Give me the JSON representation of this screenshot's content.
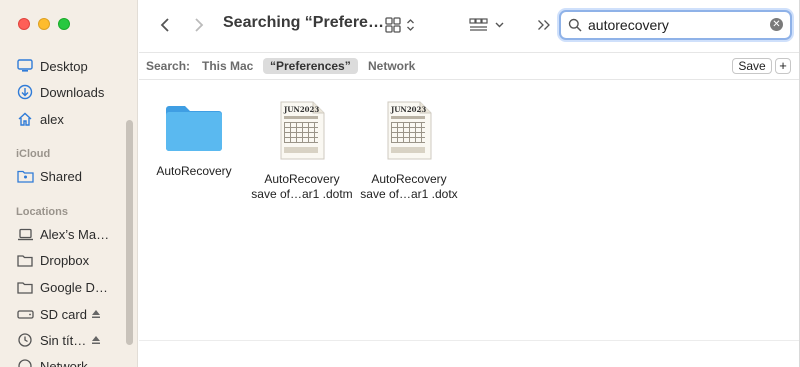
{
  "toolbar": {
    "title": "Searching “Prefere…",
    "search_value": "autorecovery"
  },
  "scope": {
    "label": "Search:",
    "options": [
      "This Mac",
      "“Preferences”",
      "Network"
    ],
    "save_label": "Save",
    "add_label": "+"
  },
  "sidebar": {
    "items_top": [
      {
        "label": "Desktop",
        "icon": "desktop-icon"
      },
      {
        "label": "Downloads",
        "icon": "downloads-icon"
      },
      {
        "label": "alex",
        "icon": "home-icon"
      }
    ],
    "icloud_heading": "iCloud",
    "icloud_items": [
      {
        "label": "Shared",
        "icon": "shared-folder-icon"
      }
    ],
    "locations_heading": "Locations",
    "location_items": [
      {
        "label": "Alex’s Ma…",
        "icon": "laptop-icon"
      },
      {
        "label": "Dropbox",
        "icon": "folder-icon"
      },
      {
        "label": "Google D…",
        "icon": "folder-icon"
      },
      {
        "label": "SD card",
        "icon": "drive-icon"
      },
      {
        "label": "Sin tít…",
        "icon": "clock-icon"
      },
      {
        "label": "Network",
        "icon": "network-icon"
      }
    ]
  },
  "files": [
    {
      "name_line1": "AutoRecovery",
      "name_line2": "",
      "icon": "folder-icon"
    },
    {
      "name_line1": "AutoRecovery",
      "name_line2": "save of…ar1 .dotm",
      "icon": "calendar-template-icon"
    },
    {
      "name_line1": "AutoRecovery",
      "name_line2": "save of…ar1 .dotx",
      "icon": "calendar-template-icon"
    }
  ],
  "thumbnail_month": "JUN2023",
  "colors": {
    "sidebar_bg": "#f4eee6",
    "accent_blue": "#2f7bd8",
    "folder_blue": "#5ab3ee"
  }
}
